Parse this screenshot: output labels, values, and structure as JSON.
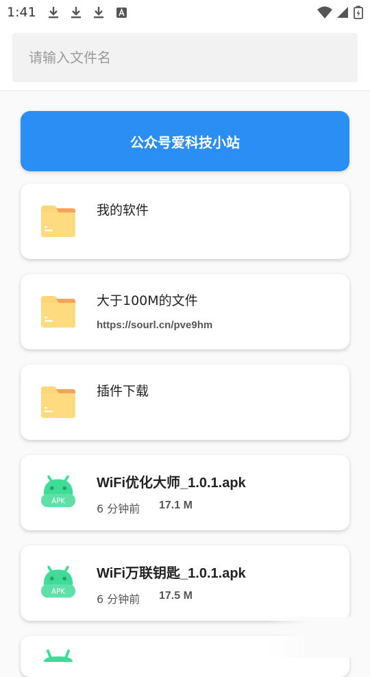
{
  "status_bar": {
    "time": "1:41",
    "left_icons": [
      "download-icon",
      "download-icon",
      "download-icon",
      "a-icon"
    ],
    "right_icons": [
      "wifi-icon",
      "signal-icon",
      "battery-charging-icon"
    ]
  },
  "search": {
    "placeholder": "请输入文件名",
    "value": ""
  },
  "banner": {
    "label": "公众号爱科技小站",
    "color": "#2b8ef2"
  },
  "folders": [
    {
      "title": "我的软件",
      "subtitle": "",
      "icon": "folder-icon"
    },
    {
      "title": "大于100M的文件",
      "subtitle": "https://sourl.cn/pve9hm",
      "icon": "folder-icon"
    },
    {
      "title": "插件下载",
      "subtitle": "",
      "icon": "folder-icon"
    }
  ],
  "files": [
    {
      "title": "WiFi优化大师_1.0.1.apk",
      "time": "6 分钟前",
      "size": "17.1 M",
      "icon": "apk-android-icon",
      "badge": "APK"
    },
    {
      "title": "WiFi万联钥匙_1.0.1.apk",
      "time": "6 分钟前",
      "size": "17.5 M",
      "icon": "apk-android-icon",
      "badge": "APK"
    }
  ],
  "colors": {
    "folder": "#fdd67a",
    "folder_tab": "#f5a35c",
    "apk": "#3ddc97"
  }
}
